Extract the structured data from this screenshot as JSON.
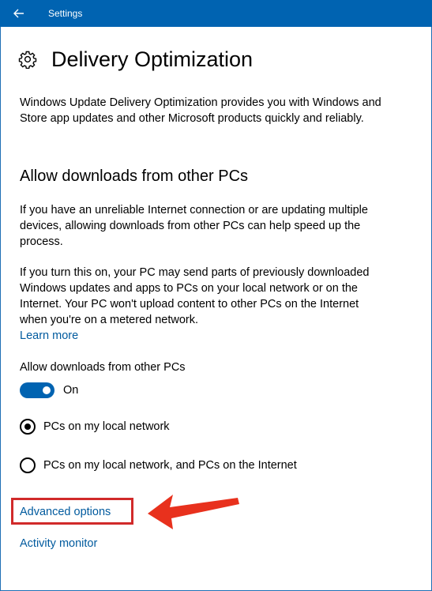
{
  "window": {
    "title": "Settings"
  },
  "page": {
    "title": "Delivery Optimization",
    "intro": "Windows Update Delivery Optimization provides you with Windows and Store app updates and other Microsoft products quickly and reliably."
  },
  "section": {
    "title": "Allow downloads from other PCs",
    "para1": "If you have an unreliable Internet connection or are updating multiple devices, allowing downloads from other PCs can help speed up the process.",
    "para2": "If you turn this on, your PC may send parts of previously downloaded Windows updates and apps to PCs on your local network or on the Internet. Your PC won't upload content to other PCs on the Internet when you're on a metered network.",
    "learn_more": "Learn more"
  },
  "toggle": {
    "label": "Allow downloads from other PCs",
    "state": "On",
    "on": true
  },
  "radios": [
    {
      "label": "PCs on my local network",
      "selected": true
    },
    {
      "label": "PCs on my local network, and PCs on the Internet",
      "selected": false
    }
  ],
  "links": {
    "advanced": "Advanced options",
    "activity": "Activity monitor"
  },
  "colors": {
    "accent": "#0063b1",
    "link": "#005a9e",
    "annotation": "#d12a2a"
  }
}
